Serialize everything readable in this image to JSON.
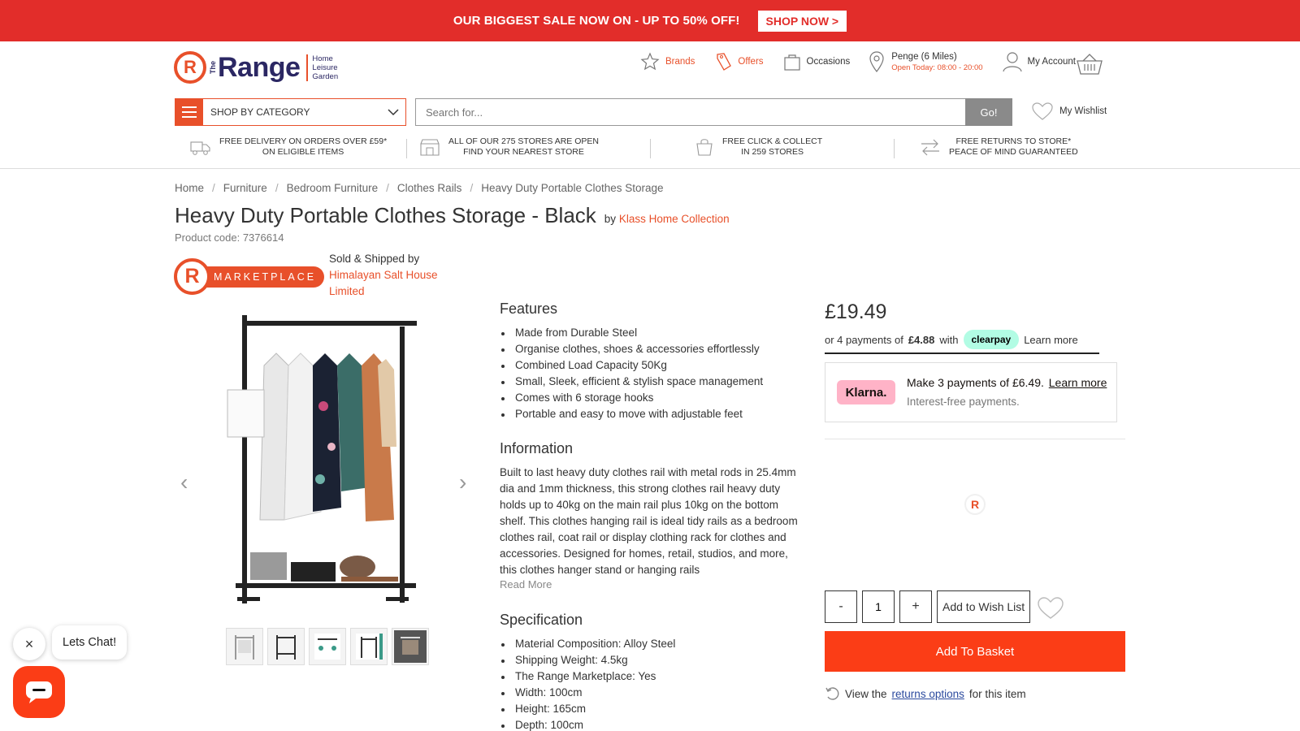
{
  "promo": {
    "text": "OUR BIGGEST SALE NOW ON - UP TO 50% OFF!",
    "button": "SHOP NOW >"
  },
  "logo": {
    "letter": "R",
    "the": "The",
    "word": "Range",
    "tag_1": "Home",
    "tag_2": "Leisure",
    "tag_3": "Garden"
  },
  "header": {
    "brands": "Brands",
    "offers": "Offers",
    "occasions": "Occasions",
    "store_name": "Penge (6 Miles)",
    "store_hours": "Open Today: 08:00 - 20:00",
    "account": "My Account"
  },
  "search": {
    "category_label": "SHOP BY CATEGORY",
    "placeholder": "Search for...",
    "go": "Go!",
    "wishlist": "My Wishlist"
  },
  "usp": [
    {
      "line1": "FREE DELIVERY ON ORDERS OVER £59*",
      "line2": "ON ELIGIBLE ITEMS"
    },
    {
      "line1": "ALL OF OUR 275 STORES ARE OPEN",
      "line2": "FIND YOUR NEAREST STORE"
    },
    {
      "line1": "FREE CLICK & COLLECT",
      "line2": "IN 259 STORES"
    },
    {
      "line1": "FREE RETURNS TO STORE*",
      "line2": "PEACE OF MIND GUARANTEED"
    }
  ],
  "breadcrumb": [
    "Home",
    "Furniture",
    "Bedroom Furniture",
    "Clothes Rails",
    "Heavy Duty Portable Clothes Storage"
  ],
  "breadcrumb_sep": "/",
  "product": {
    "title": "Heavy Duty Portable Clothes Storage - Black",
    "by": "by",
    "brand": "Klass Home Collection",
    "code": "Product code: 7376614"
  },
  "marketplace": {
    "letter": "R",
    "label": "MARKETPLACE",
    "sold_by": "Sold & Shipped by",
    "seller": "Himalayan Salt House Limited"
  },
  "gallery": {
    "prev": "‹",
    "next": "›",
    "thumbnail_count": 5
  },
  "features": {
    "heading": "Features",
    "items": [
      "Made from Durable Steel",
      "Organise clothes, shoes & accessories effortlessly",
      "Combined Load Capacity 50Kg",
      "Small, Sleek, efficient & stylish space management",
      "Comes with 6 storage hooks",
      "Portable and easy to move with adjustable feet"
    ]
  },
  "information": {
    "heading": "Information",
    "text": "Built to last heavy duty clothes rail with metal rods in 25.4mm dia and 1mm thickness, this strong clothes rail heavy duty holds up to 40kg on the main rail plus 10kg on the bottom shelf. This clothes hanging rail is ideal tidy rails as a bedroom clothes rail, coat rail or display clothing rack for clothes and accessories. Designed for homes, retail, studios, and more, this clothes hanger stand or hanging rails",
    "read_more": "Read More"
  },
  "specification": {
    "heading": "Specification",
    "items": [
      "Material Composition: Alloy Steel",
      "Shipping Weight: 4.5kg",
      "The Range Marketplace: Yes",
      "Width: 100cm",
      "Height: 165cm",
      "Depth: 100cm"
    ]
  },
  "pricing": {
    "price": "£19.49",
    "clearpay_prefix": "or 4 payments of",
    "clearpay_amount": "£4.88",
    "clearpay_with": "with",
    "clearpay_logo": "clearpay",
    "clearpay_learn": "Learn more",
    "klarna_logo": "Klarna.",
    "klarna_line": "Make 3 payments of £6.49.",
    "klarna_learn": "Learn more",
    "klarna_sub": "Interest-free payments.",
    "loader_letter": "R"
  },
  "purchase": {
    "minus": "-",
    "qty": "1",
    "plus": "+",
    "wishlist": "Add to Wish List",
    "basket": "Add To Basket",
    "returns_prefix": "View the",
    "returns_link": "returns options",
    "returns_suffix": "for this item"
  },
  "chat": {
    "close": "×",
    "text": "Lets Chat!"
  },
  "colors": {
    "banner_red": "#e22d2a",
    "brand_orange": "#e8502a",
    "basket_orange": "#fb3d16",
    "navy": "#2b2763",
    "klarna_pink": "#ffb3c7",
    "clearpay_mint": "#b2fce4"
  }
}
